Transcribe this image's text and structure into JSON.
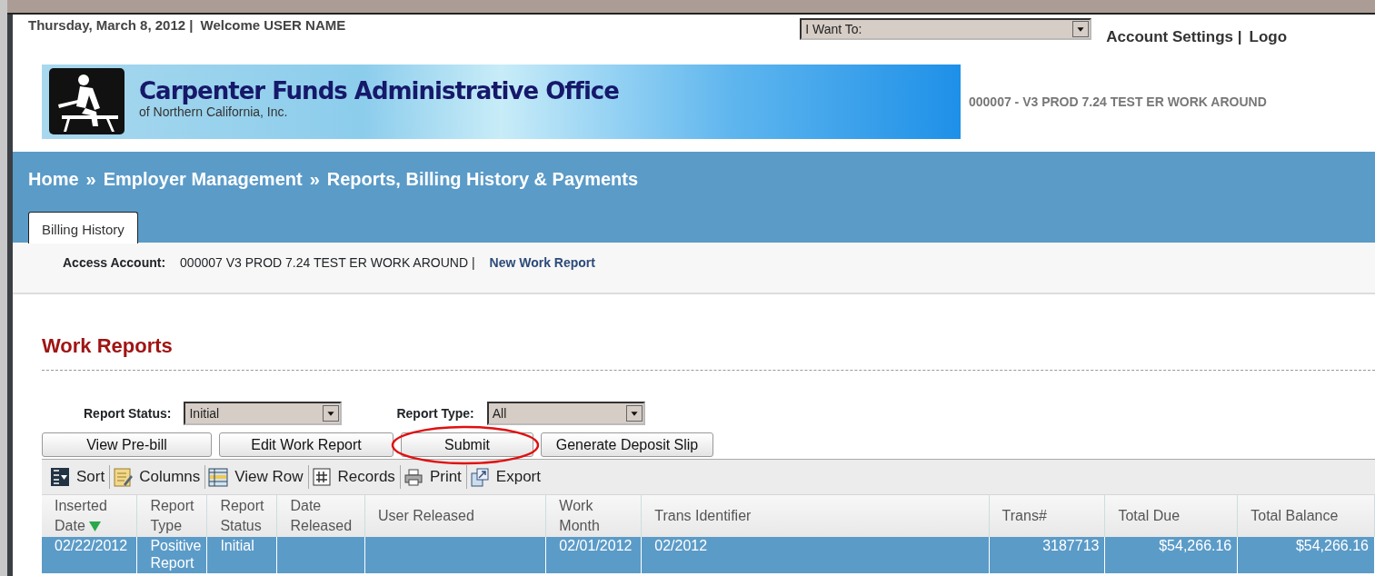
{
  "header": {
    "date": "Thursday, March 8, 2012 |",
    "welcome": "Welcome USER NAME",
    "menu": {
      "value": "I Want To:"
    },
    "links": [
      "Account Settings |",
      "Logo"
    ]
  },
  "banner": {
    "title": "Carpenter Funds Administrative Office",
    "subtitle": "of Northern California, Inc.",
    "account": "000007 - V3 PROD 7.24 TEST ER WORK AROUND"
  },
  "breadcrumb": [
    "Home",
    "»",
    "Employer Management",
    "»",
    "Reports, Billing History & Payments"
  ],
  "tabs": [
    {
      "label": "Billing History",
      "selected": true
    }
  ],
  "access_account": {
    "label": "Access Account:",
    "value": "000007 V3 PROD 7.24 TEST ER WORK AROUND |",
    "link": "New Work Report"
  },
  "section_title": "Work Reports",
  "filters": [
    {
      "label": "Report Status:",
      "value": "Initial"
    },
    {
      "label": "Report Type:",
      "value": "All"
    }
  ],
  "buttons": [
    {
      "label": "View Pre-bill",
      "highlighted": false
    },
    {
      "label": "Edit Work Report",
      "highlighted": false
    },
    {
      "label": "Submit",
      "highlighted": true
    },
    {
      "label": "Generate Deposit Slip",
      "highlighted": false
    }
  ],
  "toolbar": [
    {
      "label": "Sort",
      "kind": "sort"
    },
    {
      "label": "Columns",
      "kind": "columns"
    },
    {
      "label": "View Row",
      "kind": "viewrow"
    },
    {
      "label": "Records",
      "kind": "records"
    },
    {
      "label": "Print",
      "kind": "print"
    },
    {
      "label": "Export",
      "kind": "export"
    }
  ],
  "table": {
    "columns": [
      {
        "label": "Inserted",
        "label2": "Date",
        "kind": "text",
        "sorted": true
      },
      {
        "label": "Report",
        "label2": "Type",
        "kind": "text",
        "sorted": false
      },
      {
        "label": "Report",
        "label2": "Status",
        "kind": "text",
        "sorted": false
      },
      {
        "label": "Date",
        "label2": "Released",
        "kind": "text",
        "sorted": false
      },
      {
        "label": "User Released",
        "kind": "text",
        "sorted": false
      },
      {
        "label": "Work",
        "label2": "Month",
        "kind": "text",
        "sorted": false
      },
      {
        "label": "Trans Identifier",
        "kind": "text",
        "sorted": false
      },
      {
        "label": "Trans#",
        "kind": "number",
        "sorted": false
      },
      {
        "label": "Total Due",
        "kind": "number",
        "sorted": false
      },
      {
        "label": "Total Balance",
        "kind": "number",
        "sorted": false
      }
    ],
    "rows": [
      {
        "selected": true,
        "cells": [
          "02/22/2012",
          "Positive Report",
          "Initial",
          "",
          "",
          "02/01/2012",
          "02/2012",
          "3187713",
          "$54,266.16",
          "$54,266.16"
        ]
      }
    ]
  }
}
